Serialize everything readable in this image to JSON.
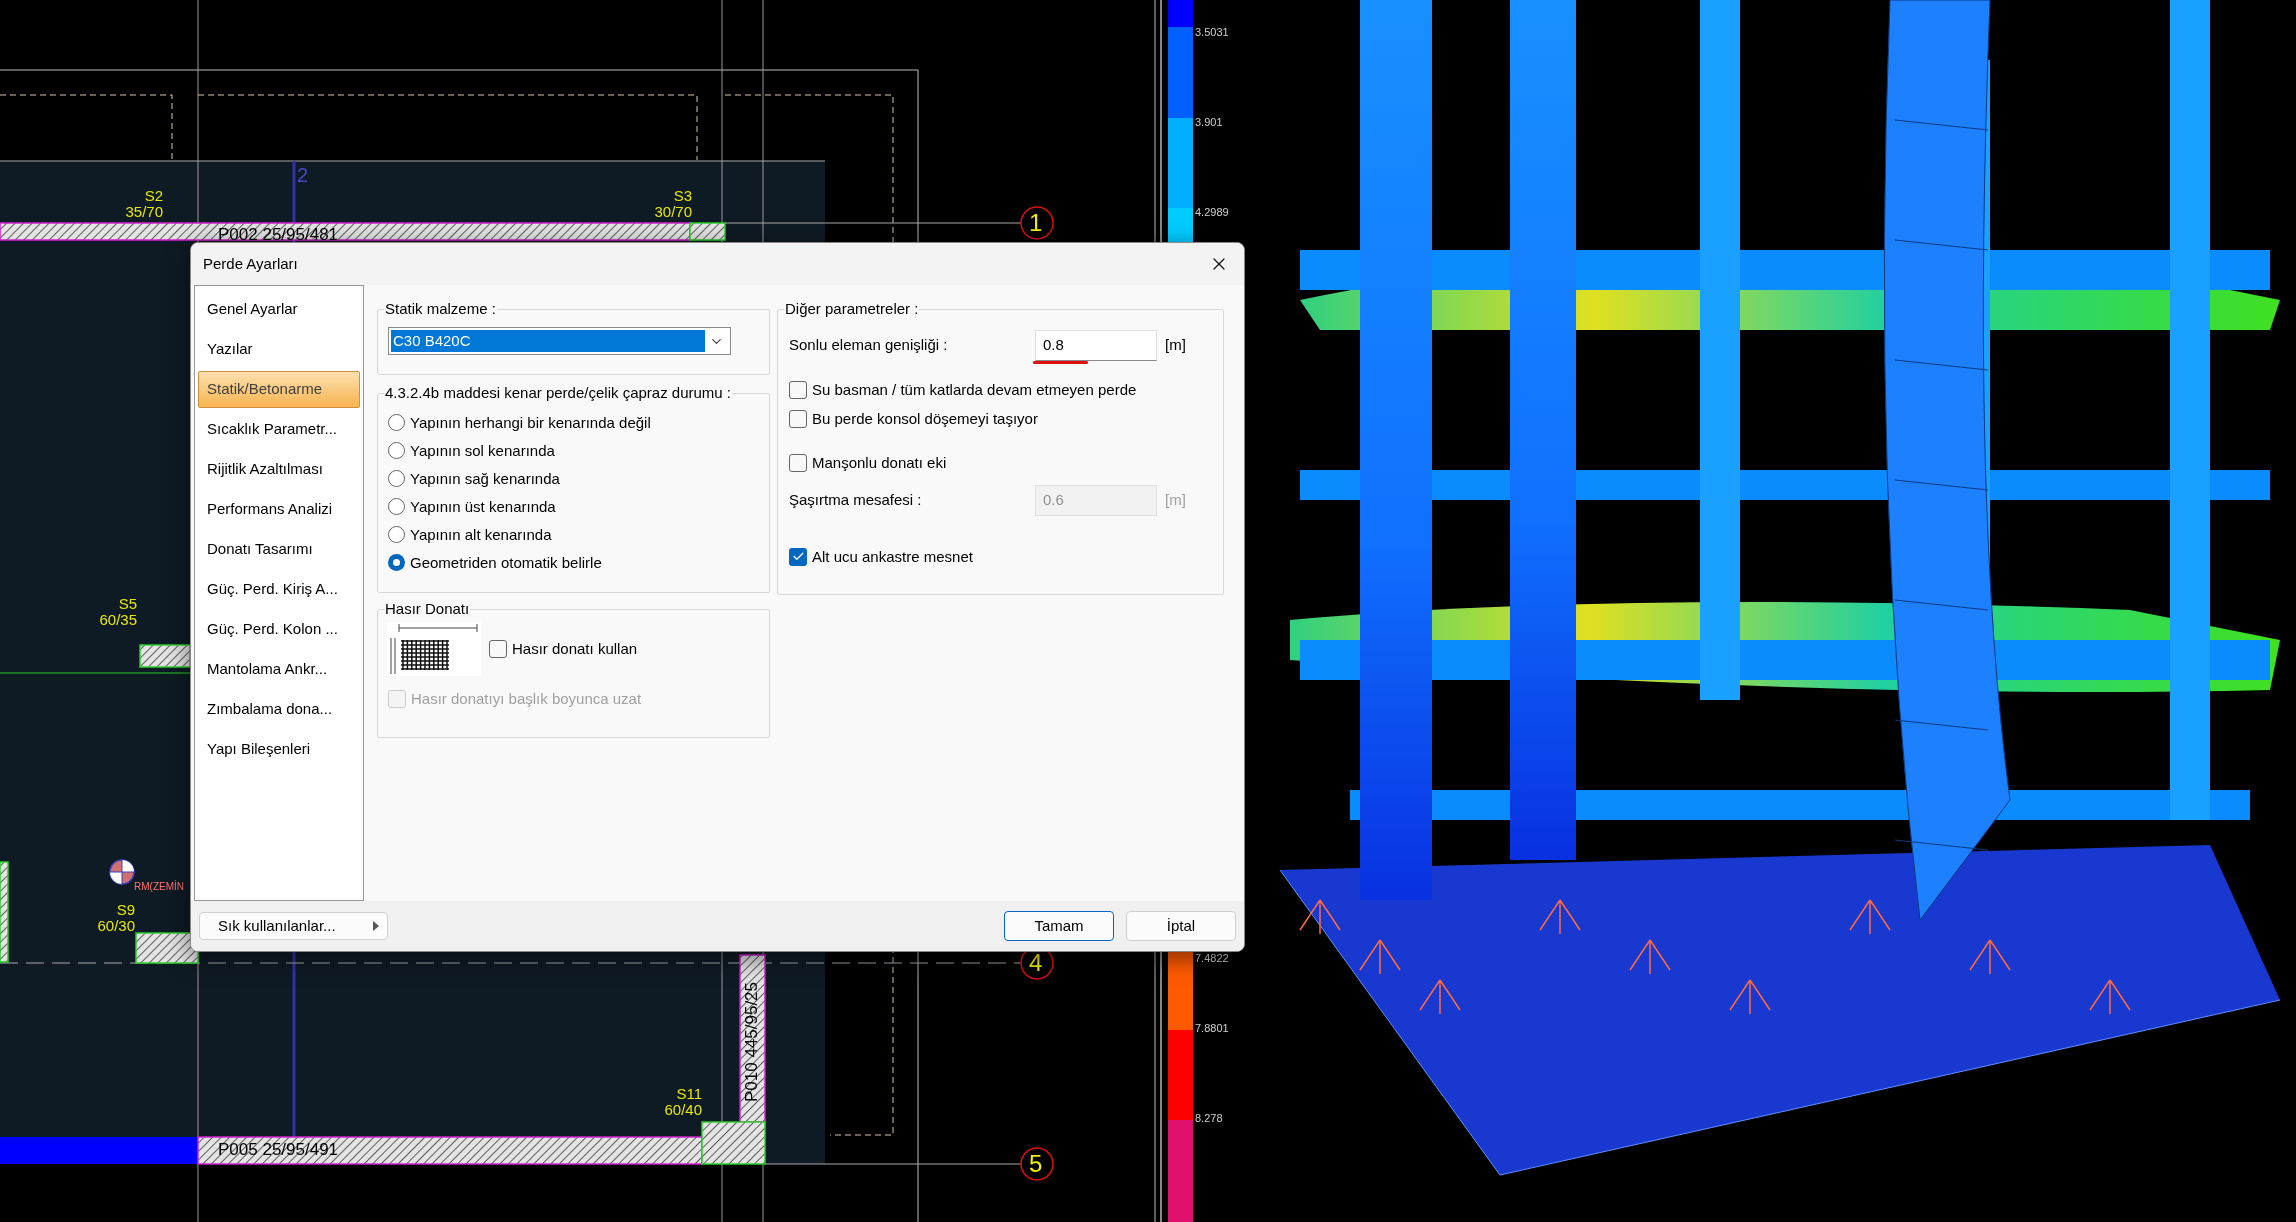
{
  "cad_plan": {
    "columns": [
      {
        "name": "S2",
        "size": "35/70"
      },
      {
        "name": "S3",
        "size": "30/70"
      },
      {
        "name": "S5",
        "size": "60/35"
      },
      {
        "name": "S9",
        "size": "60/30"
      },
      {
        "name": "S11",
        "size": "60/40"
      }
    ],
    "walls": [
      "P002 25/95/481",
      "P005 25/95/491",
      "P010 445/95/25"
    ],
    "axis_markers": [
      "1",
      "4",
      "5"
    ],
    "grid_label": "2",
    "point_label": "RM(ZEMİN"
  },
  "legend": {
    "values": [
      "3.5031",
      "3.901",
      "4.2989",
      "7.4822",
      "7.8801",
      "8.278"
    ]
  },
  "dialog": {
    "title": "Perde Ayarları",
    "sidebar": [
      {
        "label": "Genel Ayarlar",
        "selected": false
      },
      {
        "label": "Yazılar",
        "selected": false
      },
      {
        "label": "Statik/Betonarme",
        "selected": true
      },
      {
        "label": "Sıcaklık Parametr...",
        "selected": false
      },
      {
        "label": "Rijitlik Azaltılması",
        "selected": false
      },
      {
        "label": "Performans Analizi",
        "selected": false
      },
      {
        "label": "Donatı Tasarımı",
        "selected": false
      },
      {
        "label": "Güç. Perd. Kiriş A...",
        "selected": false
      },
      {
        "label": "Güç. Perd. Kolon ...",
        "selected": false
      },
      {
        "label": "Mantolama Ankr...",
        "selected": false
      },
      {
        "label": "Zımbalama dona...",
        "selected": false
      },
      {
        "label": "Yapı Bileşenleri",
        "selected": false
      }
    ],
    "material": {
      "label": "Statik malzeme :",
      "value": "C30 B420C"
    },
    "edge_group": {
      "title": "4.3.2.4b maddesi kenar perde/çelik çapraz durumu :",
      "options": [
        {
          "label": "Yapının herhangi bir kenarında değil",
          "selected": false
        },
        {
          "label": "Yapının sol kenarında",
          "selected": false
        },
        {
          "label": "Yapının sağ kenarında",
          "selected": false
        },
        {
          "label": "Yapının üst kenarında",
          "selected": false
        },
        {
          "label": "Yapının alt kenarında",
          "selected": false
        },
        {
          "label": "Geometriden otomatik belirle",
          "selected": true
        }
      ]
    },
    "mesh_group": {
      "title": "Hasır Donatı",
      "options": [
        {
          "label": "Hasır donatı kullan",
          "checked": false,
          "disabled": false
        },
        {
          "label": "Hasır donatıyı başlık boyunca uzat",
          "checked": false,
          "disabled": true
        }
      ]
    },
    "other_group": {
      "title": "Diğer parametreler :",
      "items": [
        {
          "kind": "field",
          "label": "Sonlu eleman genişliği :",
          "value": "0.8",
          "unit": "[m]",
          "disabled": false,
          "underlined": true
        },
        {
          "kind": "checkbox",
          "label": "Su basman / tüm katlarda devam etmeyen perde",
          "checked": false
        },
        {
          "kind": "checkbox",
          "label": "Bu perde konsol döşemeyi taşıyor",
          "checked": false
        },
        {
          "kind": "checkbox",
          "label": "Manşonlu donatı eki",
          "checked": false
        },
        {
          "kind": "field",
          "label": "Şaşırtma mesafesi :",
          "value": "0.6",
          "unit": "[m]",
          "disabled": true,
          "underlined": false
        },
        {
          "kind": "checkbox",
          "label": "Alt ucu ankastre mesnet",
          "checked": true
        }
      ]
    },
    "favorites_button": "Sık kullanılanlar...",
    "buttons": [
      {
        "label": "Tamam",
        "default": true
      },
      {
        "label": "İptal",
        "default": false
      }
    ]
  }
}
